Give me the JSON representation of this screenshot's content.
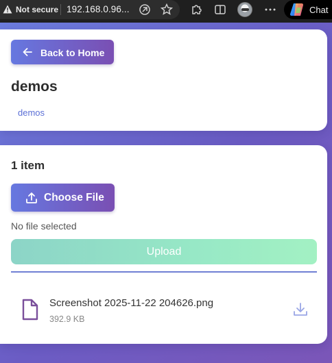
{
  "browser": {
    "security_label": "Not secure",
    "url": "192.168.0.96...",
    "copilot_label": "Chat"
  },
  "header": {
    "back_label": "Back to Home",
    "title": "demos",
    "breadcrumb": "demos"
  },
  "files": {
    "count_label": "1 item",
    "choose_label": "Choose File",
    "no_file_label": "No file selected",
    "upload_label": "Upload",
    "items": [
      {
        "name": "Screenshot 2025-11-22 204626.png",
        "size": "392.9 KB"
      }
    ]
  },
  "colors": {
    "accent_start": "#6678e0",
    "accent_end": "#7a4fb3",
    "upload_start": "#86d2c4",
    "upload_end": "#9ef0c0",
    "file_icon": "#7a4f9b",
    "download_icon": "#9aa6e6"
  },
  "icons": {
    "back": "arrow-left-icon",
    "choose": "upload-icon",
    "file": "file-icon",
    "download": "download-icon"
  }
}
